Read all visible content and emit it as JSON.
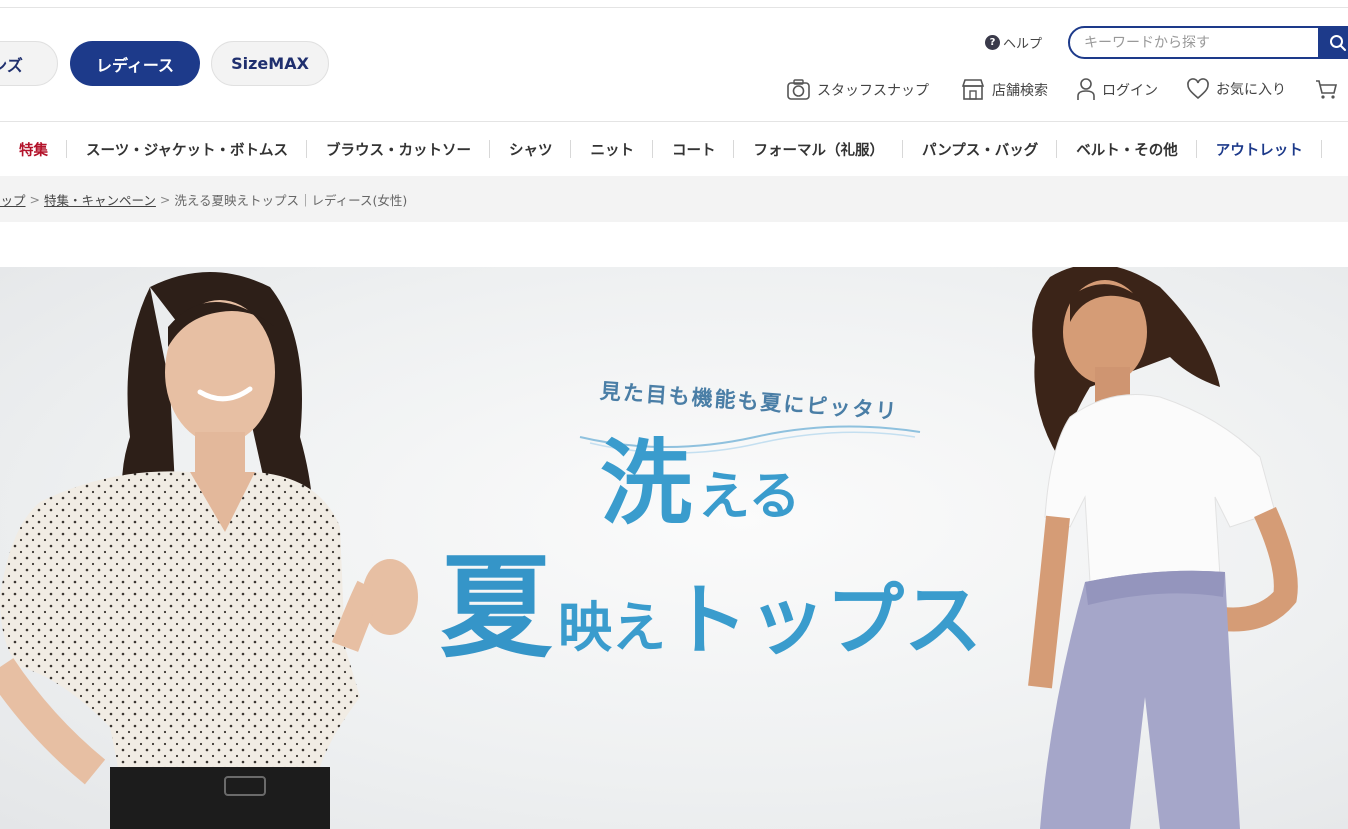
{
  "header": {
    "gender_tabs": [
      {
        "label": "メンズ"
      },
      {
        "label": "レディース"
      },
      {
        "label": "SizeMAX"
      }
    ],
    "help_label": "ヘルプ",
    "search": {
      "placeholder": "キーワードから探す",
      "value": ""
    },
    "utility_links": [
      {
        "label": "スタッフスナップ",
        "icon": "camera-icon"
      },
      {
        "label": "店舗検索",
        "icon": "store-icon"
      },
      {
        "label": "ログイン",
        "icon": "user-icon"
      },
      {
        "label": "お気に入り",
        "icon": "heart-icon"
      },
      {
        "label": "",
        "icon": "cart-icon"
      }
    ]
  },
  "nav": {
    "items": [
      "特集",
      "スーツ・ジャケット・ボトムス",
      "ブラウス・カットソー",
      "シャツ",
      "ニット",
      "コート",
      "フォーマル（礼服）",
      "パンプス・バッグ",
      "ベルト・その他",
      "アウトレット"
    ]
  },
  "breadcrumb": {
    "items": [
      "トップ",
      "特集・キャンペーン"
    ],
    "current": "洗える夏映えトップス｜レディース(女性)",
    "separator": ">"
  },
  "hero": {
    "tagline": "見た目も機能も夏にピッタリ",
    "headline_line1_big": "洗",
    "headline_line1_rest": "える",
    "headline_line2_big": "夏",
    "headline_line2_mid": "映え",
    "headline_line2_rest": "トップス",
    "accent_color": "#3a9ccd"
  },
  "colors": {
    "brand_navy": "#1d3a8a",
    "feature_red": "#b3122a"
  }
}
